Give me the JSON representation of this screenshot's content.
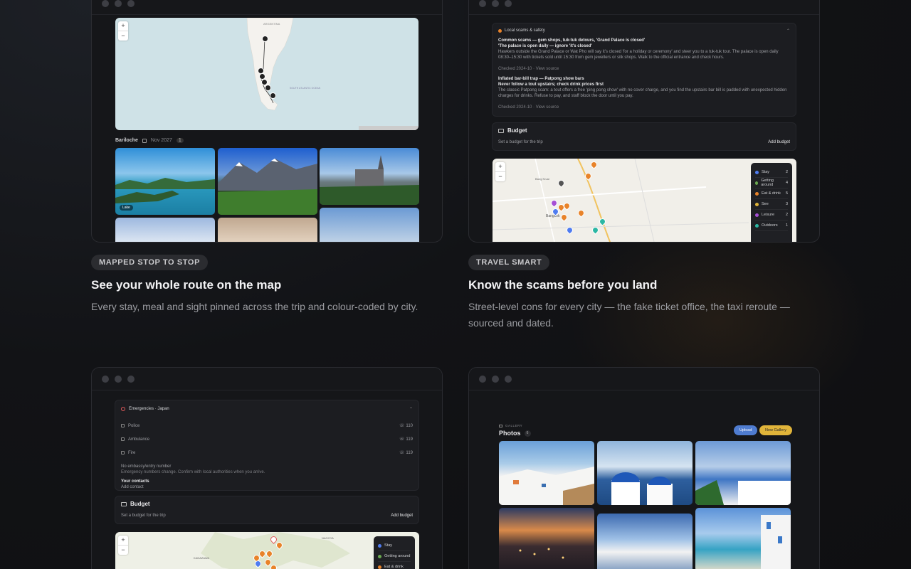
{
  "features": [
    {
      "badge": "MAPPED STOP TO STOP",
      "title": "See your whole route on the map",
      "desc": "Every stay, meal and sight pinned across the trip and colour-coded by city."
    },
    {
      "badge": "TRAVEL SMART",
      "title": "Know the scams before you land",
      "desc": "Street-level cons for every city — the fake ticket office, the taxi reroute — sourced and dated."
    }
  ],
  "card1": {
    "zoom_in": "+",
    "zoom_out": "−",
    "city": "Bariloche",
    "city_meta": "Nov 2027",
    "pin_number": "1",
    "map_labels": [
      "ARGENTINA",
      "SOUTH ATLANTIC OCEAN"
    ],
    "thumb_caption": "Lake"
  },
  "card2": {
    "section_title": "Local scams & safety",
    "scam1_title": "Common scams — gem shops, tuk-tuk detours, 'Grand Palace is closed'",
    "scam1_sub": "'The palace is open daily — ignore 'it's closed'",
    "scam1_body": "Hawkers outside the Grand Palace or Wat Pho will say it's closed 'for a holiday or ceremony' and steer you to a tuk-tuk tour. The palace is open daily 08:30–15:30 with tickets sold until 15:30 from gem jewellers or silk shops. Walk to the official entrance and check hours.",
    "scam1_meta": "Checked 2024-10 · View source",
    "scam2_title": "Inflated bar-bill trap — Patpong show bars",
    "scam2_sub": "Never follow a tout upstairs; check drink prices first",
    "scam2_body": "The classic Patpong scam: a tout offers a free 'ping pong show' with no cover charge, and you find the upstairs bar bill is padded with unexpected hidden charges for drinks. Refuse to pay, and staff block the door until you pay.",
    "scam2_meta": "Checked 2024-10 · View source",
    "budget_title": "Budget",
    "budget_sub": "Set a budget for the trip",
    "add_budget": "Add budget",
    "legend": [
      "Stay",
      "Getting around",
      "Eat & drink",
      "See",
      "Leisure",
      "Outdoors"
    ],
    "legend_counts": [
      "2",
      "4",
      "5",
      "3",
      "2",
      "1"
    ],
    "map_labels": [
      "Bang Kruai",
      "Bangkok"
    ]
  },
  "card3": {
    "section_title": "Emergencies · Japan",
    "rows": [
      {
        "label": "Police",
        "number": "110"
      },
      {
        "label": "Ambulance",
        "number": "119"
      },
      {
        "label": "Fire",
        "number": "119"
      }
    ],
    "embassy": "No embassy/entry number",
    "embassy_sub": "Emergency numbers change. Confirm with local authorities when you arrive.",
    "contacts_title": "Your contacts",
    "add_contact": "Add contact",
    "budget_title": "Budget",
    "budget_sub": "Set a budget for the trip",
    "add_budget": "Add budget",
    "legend": [
      "Stay",
      "Getting around",
      "Eat & drink"
    ],
    "map_labels": [
      "KANAZAWA",
      "NAGOYA"
    ]
  },
  "card4": {
    "gallery_label": "GALLERY",
    "title": "Photos",
    "count": "6",
    "upload": "Upload",
    "new_gallery": "New Gallery"
  },
  "colors": {
    "stay": "#4f7cf0",
    "getting_around": "#6aa84f",
    "eat": "#e8832a",
    "see": "#e0b43a",
    "leisure": "#a64fd4",
    "outdoors": "#2cb7a3"
  }
}
